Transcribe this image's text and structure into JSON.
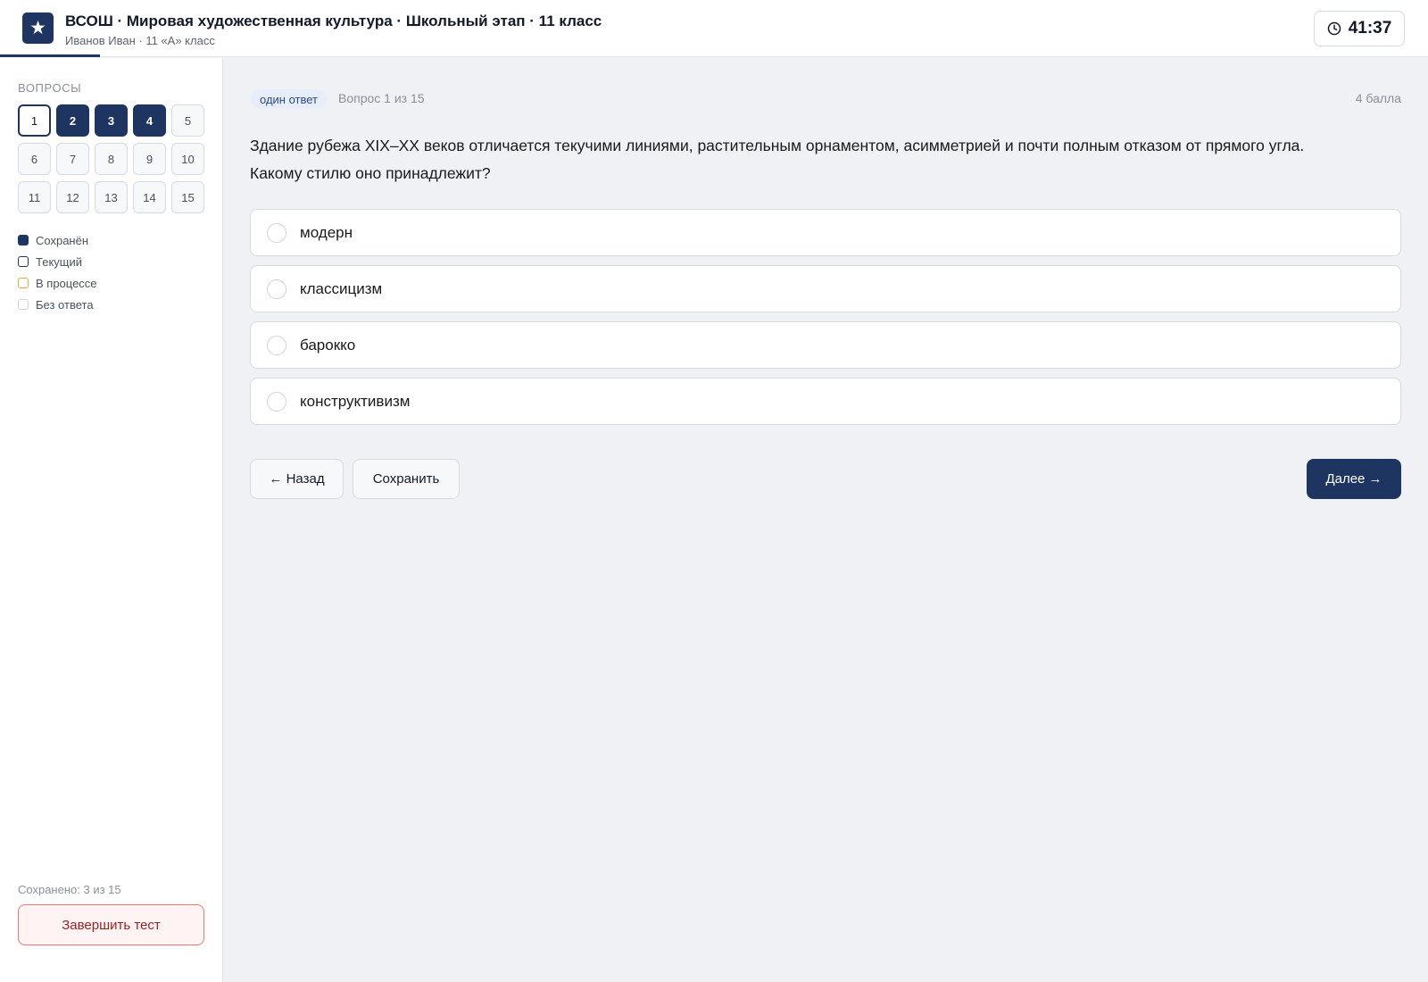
{
  "header": {
    "logo_glyph": "★",
    "title": "ВСОШ · Мировая художественная культура · Школьный этап · 11 класс",
    "subtitle": "Иванов Иван · 11 «А» класс",
    "timer": "41:37"
  },
  "sidebar": {
    "heading": "Вопросы",
    "questions": [
      {
        "label": "1",
        "state": "current"
      },
      {
        "label": "2",
        "state": "saved"
      },
      {
        "label": "3",
        "state": "saved"
      },
      {
        "label": "4",
        "state": "saved"
      },
      {
        "label": "5",
        "state": "none"
      },
      {
        "label": "6",
        "state": "none"
      },
      {
        "label": "7",
        "state": "none"
      },
      {
        "label": "8",
        "state": "none"
      },
      {
        "label": "9",
        "state": "none"
      },
      {
        "label": "10",
        "state": "none"
      },
      {
        "label": "11",
        "state": "none"
      },
      {
        "label": "12",
        "state": "none"
      },
      {
        "label": "13",
        "state": "none"
      },
      {
        "label": "14",
        "state": "none"
      },
      {
        "label": "15",
        "state": "none"
      }
    ],
    "legend": [
      {
        "label": "Сохранён",
        "kind": "saved"
      },
      {
        "label": "Текущий",
        "kind": "current"
      },
      {
        "label": "В процессе",
        "kind": "progress"
      },
      {
        "label": "Без ответа",
        "kind": "none"
      }
    ],
    "saved_count": "Сохранено: 3 из 15",
    "finish_label": "Завершить тест"
  },
  "main": {
    "type_badge": "один ответ",
    "counter": "Вопрос 1 из 15",
    "points": "4 балла",
    "question_line1": "Здание рубежа XIX–XX веков отличается текучими линиями, растительным орнаментом, асимметрией и почти полным отказом от прямого угла.",
    "question_line2": "Какому стилю оно принадлежит?",
    "options": [
      {
        "label": "модерн"
      },
      {
        "label": "классицизм"
      },
      {
        "label": "барокко"
      },
      {
        "label": "конструктивизм"
      }
    ],
    "back_label": "← Назад",
    "save_label": "Сохранить",
    "next_label": "Далее →"
  },
  "colors": {
    "accent": "#1f3561",
    "progress": "#e8a93b",
    "danger": "#9a1f1f"
  }
}
